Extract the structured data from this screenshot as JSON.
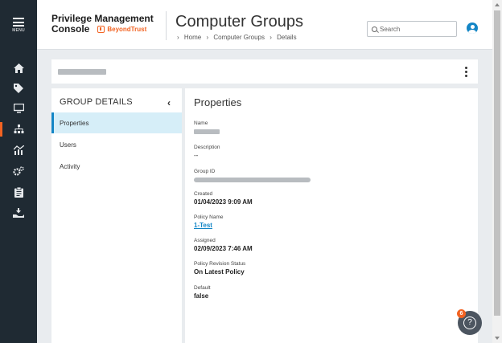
{
  "nav": {
    "menu_label": "MENU",
    "items": [
      {
        "icon": "home-icon"
      },
      {
        "icon": "tag-icon"
      },
      {
        "icon": "monitor-icon"
      },
      {
        "icon": "sitemap-icon"
      },
      {
        "icon": "analytics-icon"
      },
      {
        "icon": "gears-icon"
      },
      {
        "icon": "clipboard-icon"
      },
      {
        "icon": "hand-download-icon"
      }
    ],
    "active_index": 3,
    "accent_color": "#f26322"
  },
  "header": {
    "brand_line1": "Privilege Management",
    "brand_line2": "Console",
    "logo_text": "BeyondTrust",
    "title": "Computer Groups",
    "breadcrumb": [
      "Home",
      "Computer Groups",
      "Details"
    ],
    "search_placeholder": "Search"
  },
  "group_details": {
    "title": "GROUP DETAILS",
    "items": [
      "Properties",
      "Users",
      "Activity"
    ],
    "active": "Properties"
  },
  "properties": {
    "title": "Properties",
    "name_label": "Name",
    "description_label": "Description",
    "description_value": "--",
    "group_id_label": "Group ID",
    "created_label": "Created",
    "created_value": "01/04/2023 9:09 AM",
    "policy_name_label": "Policy Name",
    "policy_name_value": "1-Test",
    "assigned_label": "Assigned",
    "assigned_value": "02/09/2023 7:46 AM",
    "policy_revision_label": "Policy Revision Status",
    "policy_revision_value": "On Latest Policy",
    "default_label": "Default",
    "default_value": "false"
  },
  "help": {
    "badge_count": "6"
  }
}
